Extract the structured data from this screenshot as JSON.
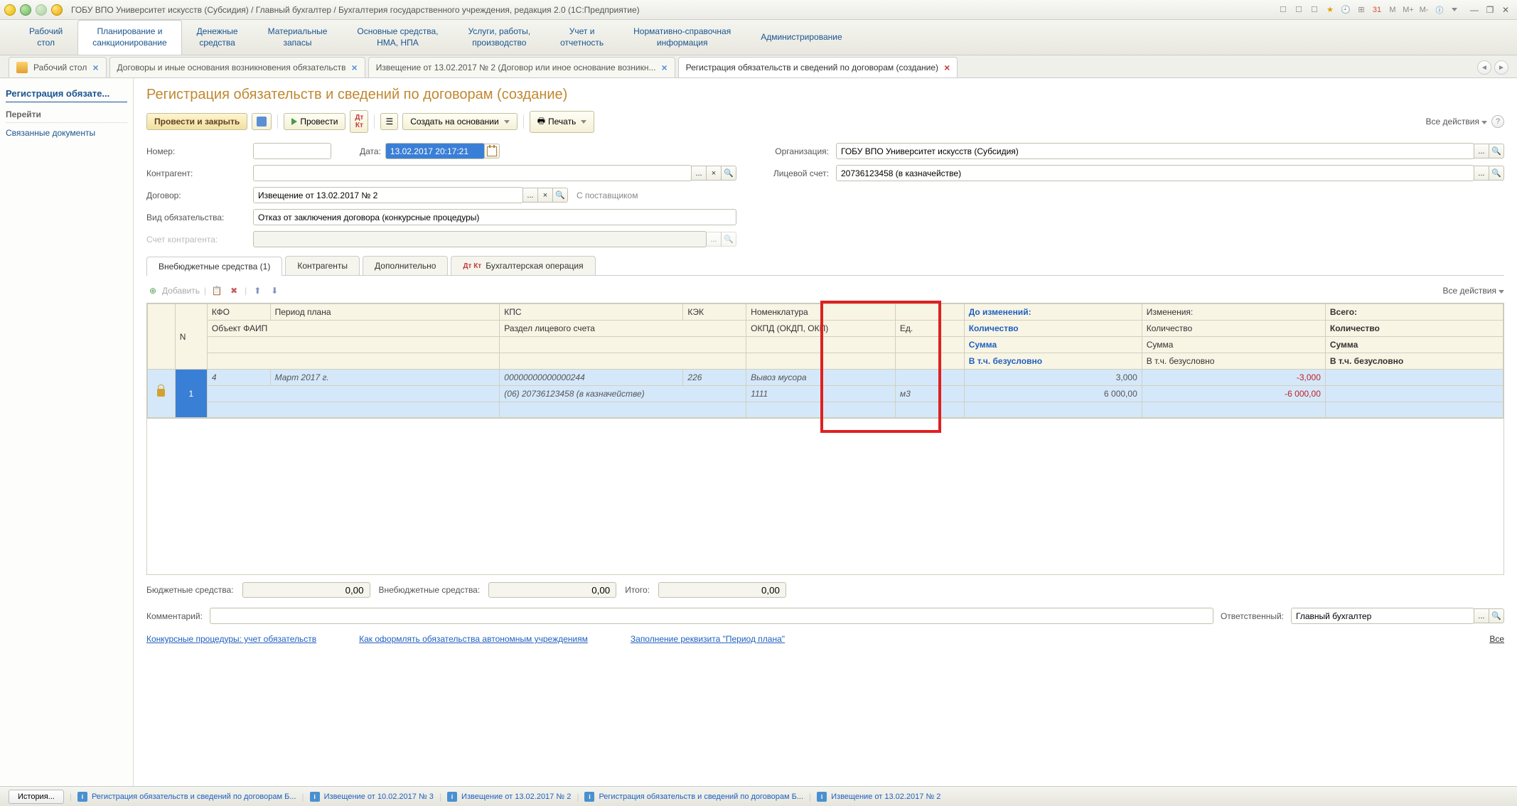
{
  "titlebar": {
    "text": "ГОБУ ВПО Университет искусств (Субсидия) / Главный бухгалтер / Бухгалтерия государственного учреждения, редакция 2.0  (1С:Предприятие)",
    "right_icons": [
      "fav",
      "cal",
      "calc",
      "M",
      "M+",
      "M-",
      "help"
    ]
  },
  "sections": [
    "Рабочий\nстол",
    "Планирование и\nсанкционирование",
    "Денежные\nсредства",
    "Материальные\nзапасы",
    "Основные средства,\nНМА, НПА",
    "Услуги, работы,\nпроизводство",
    "Учет и\nотчетность",
    "Нормативно-справочная\nинформация",
    "Администрирование"
  ],
  "doc_tabs": {
    "desktop": "Рабочий стол",
    "t1": "Договоры и иные основания возникновения обязательств",
    "t2": "Извещение от 13.02.2017 № 2 (Договор или иное основание возникн...",
    "t3": "Регистрация обязательств и сведений по договорам (создание)"
  },
  "sidebar": {
    "title": "Регистрация обязате...",
    "heading": "Перейти",
    "link1": "Связанные документы"
  },
  "page_title": "Регистрация обязательств и сведений по договорам (создание)",
  "toolbar": {
    "post_close": "Провести и закрыть",
    "post": "Провести",
    "create_based": "Создать на основании",
    "print": "Печать",
    "all_actions": "Все действия"
  },
  "form": {
    "number_label": "Номер:",
    "number": "",
    "date_label": "Дата:",
    "date": "13.02.2017 20:17:21",
    "org_label": "Организация:",
    "org": "ГОБУ ВПО Университет искусств (Субсидия)",
    "contragent_label": "Контрагент:",
    "contragent": "",
    "account_label": "Лицевой счет:",
    "account": "20736123458 (в казначействе)",
    "contract_label": "Договор:",
    "contract": "Извещение от 13.02.2017 № 2",
    "contract_static": "С поставщиком",
    "obltype_label": "Вид обязательства:",
    "obltype": "Отказ от заключения договора (конкурсные процедуры)",
    "ctr_account_label": "Счет контрагента:",
    "ctr_account": ""
  },
  "tabs": {
    "t1": "Внебюджетные средства (1)",
    "t2": "Контрагенты",
    "t3": "Дополнительно",
    "t4": "Бухгалтерская операция"
  },
  "grid_toolbar": {
    "add": "Добавить",
    "all_actions": "Все действия"
  },
  "headers": {
    "n": "N",
    "kfo": "КФО",
    "period": "Период плана",
    "kps": "КПС",
    "kek": "КЭК",
    "nomen": "Номенклатура",
    "before": "До изменений:",
    "changes": "Изменения:",
    "total": "Всего:",
    "faip": "Объект ФАИП",
    "section": "Раздел лицевого счета",
    "okpd": "ОКПД (ОКДП, ОКП)",
    "unit": "Ед.",
    "qty": "Количество",
    "sum": "Сумма",
    "uncond": "В т.ч. безусловно"
  },
  "row": {
    "n": "1",
    "kfo": "4",
    "period": "Март 2017 г.",
    "kps": "00000000000000244",
    "kek": "226",
    "nomen": "Вывоз мусора",
    "before_qty": "3,000",
    "ch_qty": "-3,000",
    "section": "(06) 20736123458 (в казначействе)",
    "okpd": "1111",
    "unit": "м3",
    "before_sum": "6 000,00",
    "ch_sum": "-6 000,00"
  },
  "totals": {
    "budget_label": "Бюджетные средства:",
    "budget": "0,00",
    "offbudget_label": "Внебюджетные средства:",
    "offbudget": "0,00",
    "total_label": "Итого:",
    "total": "0,00"
  },
  "comment": {
    "label": "Комментарий:",
    "resp_label": "Ответственный:",
    "resp": "Главный бухгалтер"
  },
  "links": {
    "l1": "Конкурсные процедуры: учет обязательств",
    "l2": "Как оформлять обязательства автономным учреждениям",
    "l3": "Заполнение реквизита \"Период плана\"",
    "all": "Все"
  },
  "statusbar": {
    "history": "История...",
    "s1": "Регистрация обязательств и сведений по договорам Б...",
    "s2": "Извещение от 10.02.2017 № 3",
    "s3": "Извещение от 13.02.2017 № 2",
    "s4": "Регистрация обязательств и сведений по договорам Б...",
    "s5": "Извещение от 13.02.2017 № 2"
  }
}
